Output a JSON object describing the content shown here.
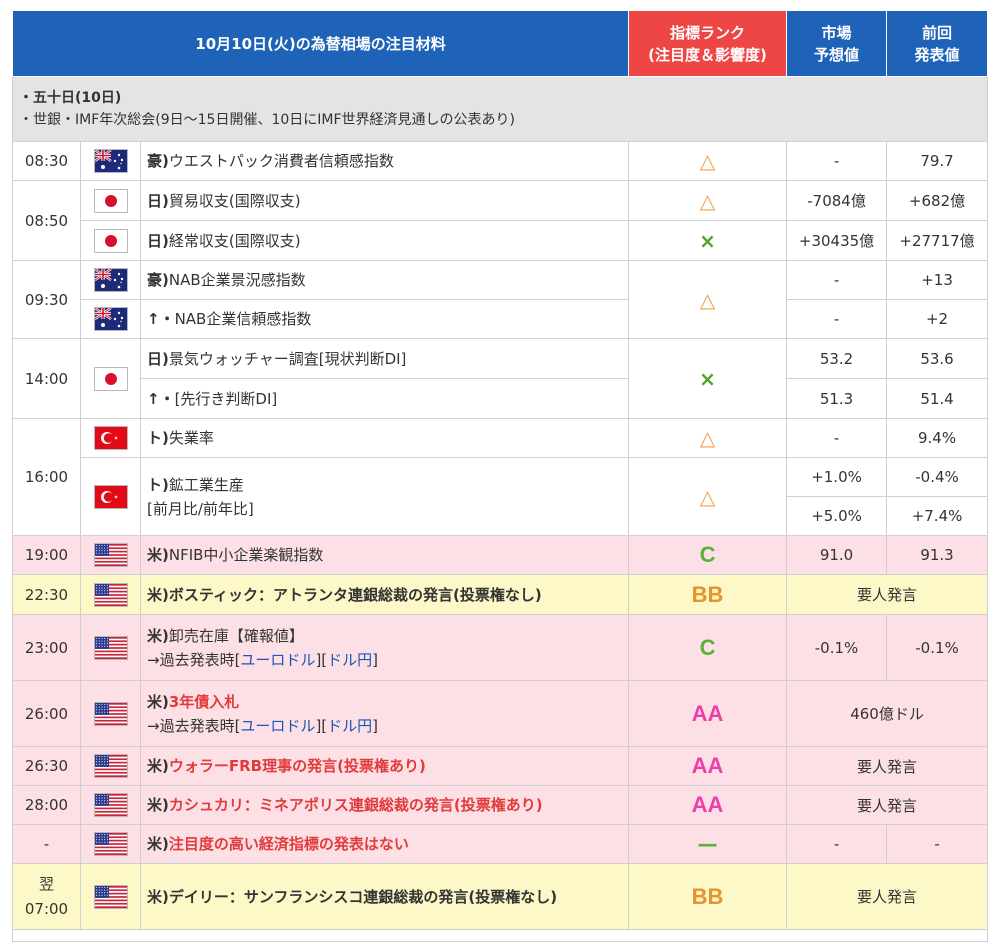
{
  "header": {
    "title": "10月10日(火)の為替相場の注目材料",
    "rank_line1": "指標ランク",
    "rank_line2": "(注目度＆影響度)",
    "forecast_line1": "市場",
    "forecast_line2": "予想値",
    "previous_line1": "前回",
    "previous_line2": "発表値"
  },
  "notice": {
    "line1": "・五十日(10日)",
    "line2": "・世銀・IMF年次総会(9日～15日開催、10日にIMF世界経済見通しの公表あり)"
  },
  "colors": {
    "header_blue": "#1f63b8",
    "header_red": "#ee4545",
    "pink_row": "#fde0e5",
    "yellow_row": "#fdf8c8"
  },
  "rows": [
    {
      "time": "08:30",
      "flag": "australia-flag-icon",
      "prefix": "豪)",
      "text": "ウエストパック消費者信頼感指数",
      "rank": "△",
      "forecast": "-",
      "previous": "79.7"
    },
    {
      "time": "08:50",
      "flag": "japan-flag-icon",
      "prefix": "日)",
      "text": "貿易収支(国際収支)",
      "rank": "△",
      "forecast": "-7084億",
      "previous": "+682億"
    },
    {
      "flag": "japan-flag-icon",
      "prefix": "日)",
      "text": "経常収支(国際収支)",
      "rank": "×",
      "forecast": "+30435億",
      "previous": "+27717億"
    },
    {
      "time": "09:30",
      "flag": "australia-flag-icon",
      "prefix": "豪)",
      "text": "NAB企業景況感指数",
      "rank": "△",
      "forecast": "-",
      "previous": "+13"
    },
    {
      "flag": "australia-flag-icon",
      "prefix": "↑・",
      "text": "NAB企業信頼感指数",
      "forecast": "-",
      "previous": "+2"
    },
    {
      "time": "14:00",
      "flag": "japan-flag-icon",
      "prefix": "日)",
      "text": "景気ウォッチャー調査[現状判断DI]",
      "rank": "×",
      "forecast": "53.2",
      "previous": "53.6"
    },
    {
      "prefix": "↑・",
      "text": "[先行き判断DI]",
      "forecast": "51.3",
      "previous": "51.4"
    },
    {
      "time": "16:00",
      "flag": "turkey-flag-icon",
      "prefix": "ト)",
      "text": "失業率",
      "rank": "△",
      "forecast": "-",
      "previous": "9.4%"
    },
    {
      "flag": "turkey-flag-icon",
      "prefix": "ト)",
      "text": "鉱工業生産",
      "sub": "[前月比/前年比]",
      "rank": "△",
      "forecast": "+1.0%",
      "previous": "-0.4%",
      "forecast2": "+5.0%",
      "previous2": "+7.4%"
    },
    {
      "time": "19:00",
      "flag": "usa-flag-icon",
      "prefix": "米)",
      "text": "NFIB中小企業楽観指数",
      "rank": "C",
      "forecast": "91.0",
      "previous": "91.3"
    },
    {
      "time": "22:30",
      "flag": "usa-flag-icon",
      "prefix": "米)",
      "text": "ボスティック：アトランタ連銀総裁の発言(投票権なし)",
      "rank": "BB",
      "merged": "要人発言"
    },
    {
      "time": "23:00",
      "flag": "usa-flag-icon",
      "prefix": "米)",
      "text": "卸売在庫【確報値】",
      "sub_pre": "→過去発表時[",
      "link1": "ユーロドル",
      "mid": "][",
      "link2": "ドル円",
      "sub_post": "]",
      "rank": "C",
      "forecast": "-0.1%",
      "previous": "-0.1%"
    },
    {
      "time": "26:00",
      "flag": "usa-flag-icon",
      "prefix": "米)",
      "text": "3年債入札",
      "sub_pre": "→過去発表時[",
      "link1": "ユーロドル",
      "mid": "][",
      "link2": "ドル円",
      "sub_post": "]",
      "rank": "AA",
      "merged": "460億ドル"
    },
    {
      "time": "26:30",
      "flag": "usa-flag-icon",
      "prefix": "米)",
      "text": "ウォラーFRB理事の発言(投票権あり)",
      "rank": "AA",
      "merged": "要人発言"
    },
    {
      "time": "28:00",
      "flag": "usa-flag-icon",
      "prefix": "米)",
      "text": "カシュカリ：ミネアポリス連銀総裁の発言(投票権あり)",
      "rank": "AA",
      "merged": "要人発言"
    },
    {
      "time": "-",
      "flag": "usa-flag-icon",
      "prefix": "米)",
      "text": "注目度の高い経済指標の発表はない",
      "rank": "—",
      "forecast": "-",
      "previous": "-"
    },
    {
      "time_line1": "翌",
      "time_line2": "07:00",
      "flag": "usa-flag-icon",
      "prefix": "米)",
      "text": "デイリー：サンフランシスコ連銀総裁の発言(投票権なし)",
      "rank": "BB",
      "merged": "要人発言"
    }
  ]
}
